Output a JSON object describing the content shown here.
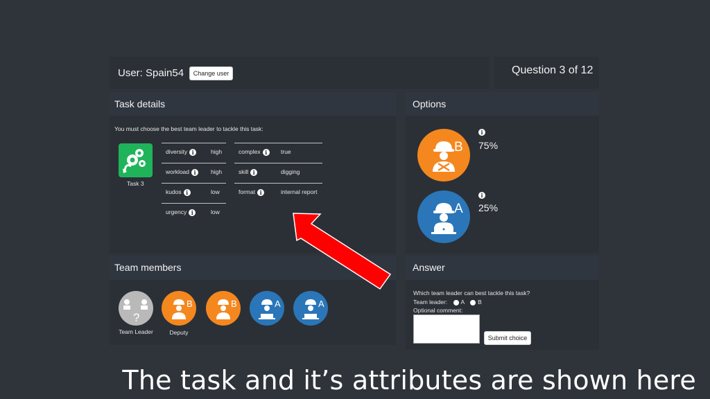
{
  "header": {
    "user_label": "User: Spain54",
    "change_user": "Change user",
    "question": "Question 3 of 12"
  },
  "task_details": {
    "title": "Task details",
    "instruction": "You must choose the best team leader to tackle this task:",
    "task_name": "Task 3",
    "attributes_left": [
      {
        "name": "diversity",
        "value": "high"
      },
      {
        "name": "workload",
        "value": "high"
      },
      {
        "name": "kudos",
        "value": "low"
      },
      {
        "name": "urgency",
        "value": "low"
      }
    ],
    "attributes_right": [
      {
        "name": "complex",
        "value": "true"
      },
      {
        "name": "skill",
        "value": "digging"
      },
      {
        "name": "format",
        "value": "internal report"
      }
    ],
    "info_glyph": "i"
  },
  "options": {
    "title": "Options",
    "items": [
      {
        "letter": "B",
        "percent": "75%",
        "color": "#f5871f",
        "icon": "construction-worker-icon"
      },
      {
        "letter": "A",
        "percent": "25%",
        "color": "#2a76b8",
        "icon": "laptop-worker-icon"
      }
    ]
  },
  "team": {
    "title": "Team members",
    "members": [
      {
        "role": "Team Leader",
        "letter": "?",
        "color": "#b9b9b9"
      },
      {
        "role": "Deputy",
        "letter": "B",
        "color": "#f5871f"
      },
      {
        "role": "",
        "letter": "B",
        "color": "#f5871f"
      },
      {
        "role": "",
        "letter": "A",
        "color": "#2a76b8"
      },
      {
        "role": "",
        "letter": "A",
        "color": "#2a76b8"
      }
    ]
  },
  "answer": {
    "title": "Answer",
    "question": "Which team leader can best tackle this task?",
    "leader_label": "Team leader:",
    "option_a": "A",
    "option_b": "B",
    "comment_label": "Optional comment:",
    "submit": "Submit choice"
  },
  "caption": "The task and it’s attributes are shown here",
  "colors": {
    "background": "#2f343b",
    "panel": "#2b3036",
    "arrow": "#ff0000",
    "task_icon": "#1fb45a"
  }
}
